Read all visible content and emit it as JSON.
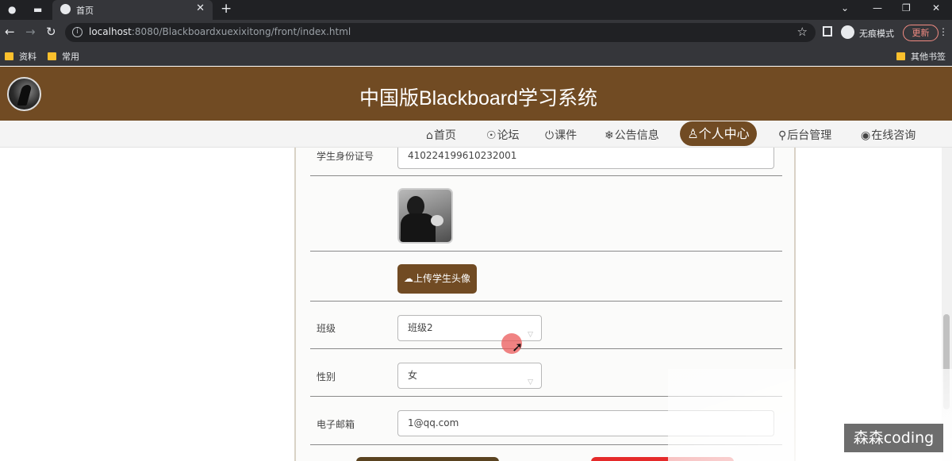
{
  "browser": {
    "tab_title": "首页",
    "url_host": "localhost",
    "url_rest": ":8080/Blackboardxuexixitong/front/index.html",
    "incognito_label": "无痕模式",
    "update_label": "更新",
    "bookmarks": [
      "资料",
      "常用"
    ],
    "other_bookmarks": "其他书签"
  },
  "site": {
    "title": "中国版Blackboard学习系统",
    "nav": {
      "home": "首页",
      "forum": "论坛",
      "course": "课件",
      "notice": "公告信息",
      "profile": "个人中心",
      "admin": "后台管理",
      "consult": "在线咨询"
    },
    "accent": "#714b23"
  },
  "form": {
    "id_label": "学生身份证号",
    "id_value": "410224199610232001",
    "upload_button": "上传学生头像",
    "class_label": "班级",
    "class_value": "班级2",
    "gender_label": "性别",
    "gender_value": "女",
    "email_label": "电子邮箱",
    "email_value": "1@qq.com"
  },
  "watermark": "森森coding"
}
